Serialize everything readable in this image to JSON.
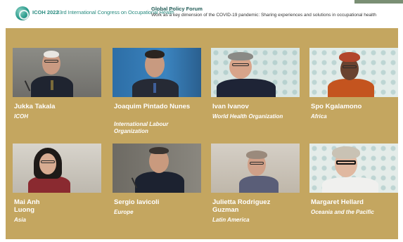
{
  "header": {
    "logo_acronym": "ICOH 2022",
    "congress_title": "33rd International Congress on Occupational Health",
    "forum_title": "Global Policy Forum",
    "forum_subtitle": "Work as a key dimension of the COVID-19 pandemic: Sharing experiences and solutions in occupational health"
  },
  "participants": [
    {
      "name": "Jukka Takala",
      "org": "ICOH"
    },
    {
      "name": "Joaquim Pintado Nunes",
      "org": "International Labour Organization"
    },
    {
      "name": "Ivan Ivanov",
      "org": "World Health Organization"
    },
    {
      "name": "Spo Kgalamono",
      "org": "Africa"
    },
    {
      "name": "Mai Anh Luong",
      "org": "Asia"
    },
    {
      "name": "Sergio Iavicoli",
      "org": "Europe"
    },
    {
      "name": "Julietta Rodriguez Guzman",
      "org": "Latin America"
    },
    {
      "name": "Margaret Hellard",
      "org": "Oceania and the Pacific"
    }
  ],
  "colors": {
    "stage_background": "#c4a660",
    "brand_teal": "#2a8c80",
    "label_text": "#ffffff"
  },
  "icons": [
    "icoh-logo-icon"
  ]
}
